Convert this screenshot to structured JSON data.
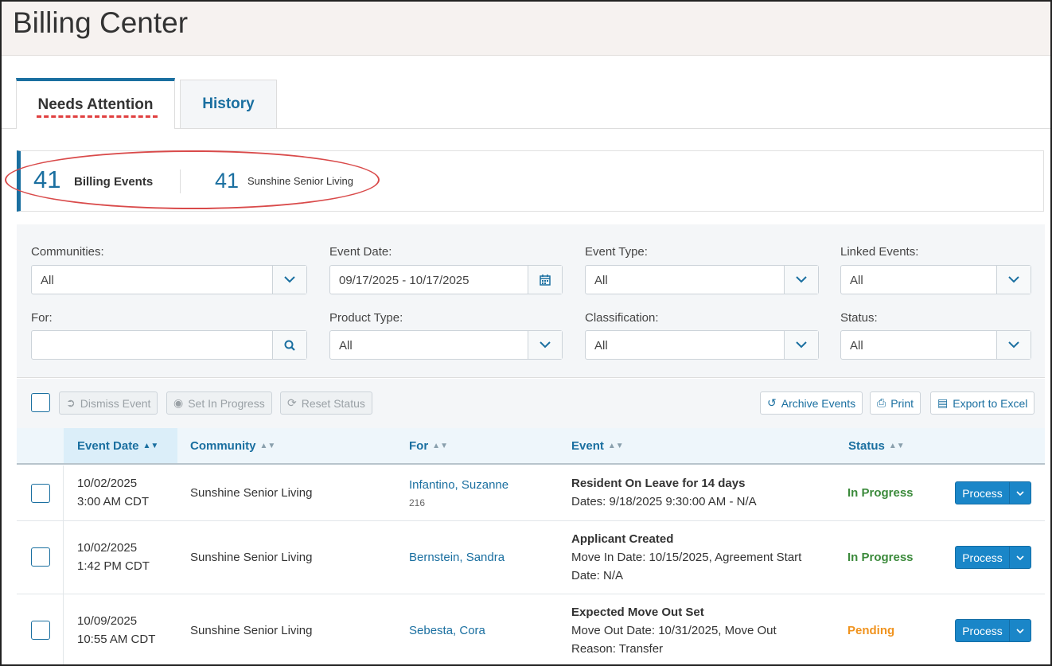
{
  "header": {
    "title": "Billing Center"
  },
  "tabs": [
    {
      "label": "Needs Attention"
    },
    {
      "label": "History"
    }
  ],
  "summary": {
    "billing_count": "41",
    "billing_label": "Billing Events",
    "community_count": "41",
    "community_label": "Sunshine Senior Living"
  },
  "filters": {
    "communities": {
      "label": "Communities:",
      "value": "All"
    },
    "event_date": {
      "label": "Event Date:",
      "value": "09/17/2025 - 10/17/2025"
    },
    "event_type": {
      "label": "Event Type:",
      "value": "All"
    },
    "linked_events": {
      "label": "Linked Events:",
      "value": "All"
    },
    "for": {
      "label": "For:",
      "value": ""
    },
    "product_type": {
      "label": "Product Type:",
      "value": "All"
    },
    "classification": {
      "label": "Classification:",
      "value": "All"
    },
    "status": {
      "label": "Status:",
      "value": "All"
    }
  },
  "toolbar": {
    "dismiss": "Dismiss Event",
    "set_in_progress": "Set In Progress",
    "reset_status": "Reset Status",
    "archive": "Archive Events",
    "print": "Print",
    "export": "Export to Excel"
  },
  "table": {
    "headers": {
      "event_date": "Event Date",
      "community": "Community",
      "for": "For",
      "event": "Event",
      "status": "Status"
    },
    "rows": [
      {
        "date": "10/02/2025",
        "time": "3:00 AM CDT",
        "community": "Sunshine Senior Living",
        "for": "Infantino, Suzanne",
        "for_sub": "216",
        "event_title": "Resident On Leave for 14 days",
        "event_line1": "Dates: 9/18/2025 9:30:00 AM - N/A",
        "event_line2": "",
        "status": "In Progress",
        "action": "Process"
      },
      {
        "date": "10/02/2025",
        "time": "1:42 PM CDT",
        "community": "Sunshine Senior Living",
        "for": "Bernstein, Sandra",
        "for_sub": "",
        "event_title": "Applicant Created",
        "event_line1": "Move In Date: 10/15/2025, Agreement Start",
        "event_line2": "Date: N/A",
        "status": "In Progress",
        "action": "Process"
      },
      {
        "date": "10/09/2025",
        "time": "10:55 AM CDT",
        "community": "Sunshine Senior Living",
        "for": "Sebesta, Cora",
        "for_sub": "",
        "event_title": "Expected Move Out Set",
        "event_line1": "Move Out Date: 10/31/2025, Move Out",
        "event_line2": "Reason: Transfer",
        "status": "Pending",
        "action": "Process"
      }
    ]
  },
  "colors": {
    "accent": "#1a6fa0",
    "in_progress": "#3b8a3b",
    "pending": "#f0931e",
    "button": "#1a86c8"
  }
}
